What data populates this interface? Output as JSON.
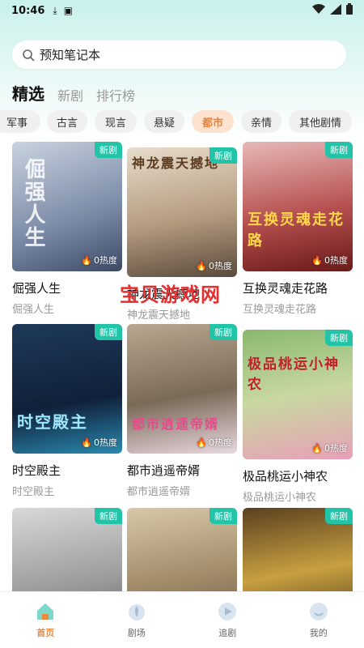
{
  "status_bar": {
    "time": "10:46"
  },
  "search": {
    "value": "预知笔记本"
  },
  "tabs": [
    {
      "label": "精选"
    },
    {
      "label": "新剧"
    },
    {
      "label": "排行榜"
    }
  ],
  "chips": [
    {
      "label": "军事"
    },
    {
      "label": "古言"
    },
    {
      "label": "现言"
    },
    {
      "label": "悬疑"
    },
    {
      "label": "都市"
    },
    {
      "label": "亲情"
    },
    {
      "label": "其他剧情"
    }
  ],
  "cards": [
    {
      "title": "倔强人生",
      "sub": "倔强人生",
      "badge": "新剧",
      "heat": "0热度",
      "poster_text": "倔强人生"
    },
    {
      "title": "神龙震天撼地",
      "sub": "神龙震天撼地",
      "badge": "新剧",
      "heat": "0热度",
      "poster_text": "神龙震天撼地"
    },
    {
      "title": "互换灵魂走花路",
      "sub": "互换灵魂走花路",
      "badge": "新剧",
      "heat": "0热度",
      "poster_text": "互换灵魂走花路"
    },
    {
      "title": "时空殿主",
      "sub": "时空殿主",
      "badge": "新剧",
      "heat": "0热度",
      "poster_text": "时空殿主"
    },
    {
      "title": "都市逍遥帝婿",
      "sub": "都市逍遥帝婿",
      "badge": "新剧",
      "heat": "0热度",
      "poster_text": "都市逍遥帝婿"
    },
    {
      "title": "极品桃运小神农",
      "sub": "极品桃运小神农",
      "badge": "新剧",
      "heat": "0热度",
      "poster_text": "极品桃运小神农"
    },
    {
      "title": "",
      "sub": "",
      "badge": "新剧",
      "heat": "",
      "poster_text": ""
    },
    {
      "title": "",
      "sub": "",
      "badge": "新剧",
      "heat": "",
      "poster_text": ""
    },
    {
      "title": "",
      "sub": "",
      "badge": "新剧",
      "heat": "",
      "poster_text": ""
    }
  ],
  "watermark": "宝贝游戏网",
  "bottom_nav": [
    {
      "label": "首页",
      "icon": "home-icon"
    },
    {
      "label": "剧场",
      "icon": "theater-icon"
    },
    {
      "label": "追剧",
      "icon": "play-icon"
    },
    {
      "label": "我的",
      "icon": "profile-icon"
    }
  ],
  "colors": {
    "accent": "#22c4a8",
    "active_chip": "#e8833c",
    "active_nav": "#f08a3c"
  }
}
